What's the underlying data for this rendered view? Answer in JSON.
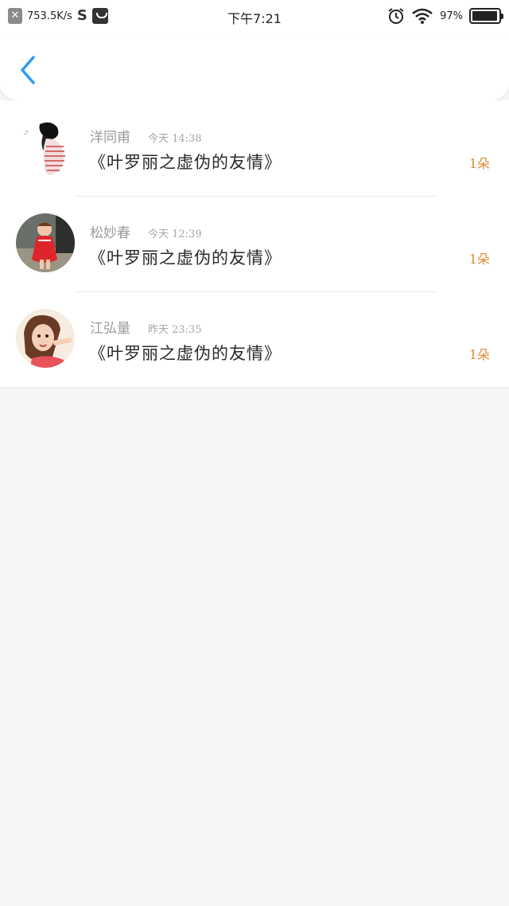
{
  "status_bar": {
    "net_speed": "753.5K/s",
    "time": "下午7:21",
    "battery_percent": "97%",
    "battery_level": 0.97
  },
  "header": {
    "back_icon": "chevron-left-icon",
    "accent_color": "#2d9cf0"
  },
  "gifts": [
    {
      "name": "洋同甫",
      "time": "今天 14:38",
      "title": "《叶罗丽之虚伪的友情》",
      "count": "1朵"
    },
    {
      "name": "松妙春",
      "time": "今天 12:39",
      "title": "《叶罗丽之虚伪的友情》",
      "count": "1朵"
    },
    {
      "name": "江弘量",
      "time": "昨天 23:35",
      "title": "《叶罗丽之虚伪的友情》",
      "count": "1朵"
    }
  ],
  "colors": {
    "count": "#d8893a",
    "name": "#9a9a9a",
    "background": "#f7f5f5"
  }
}
